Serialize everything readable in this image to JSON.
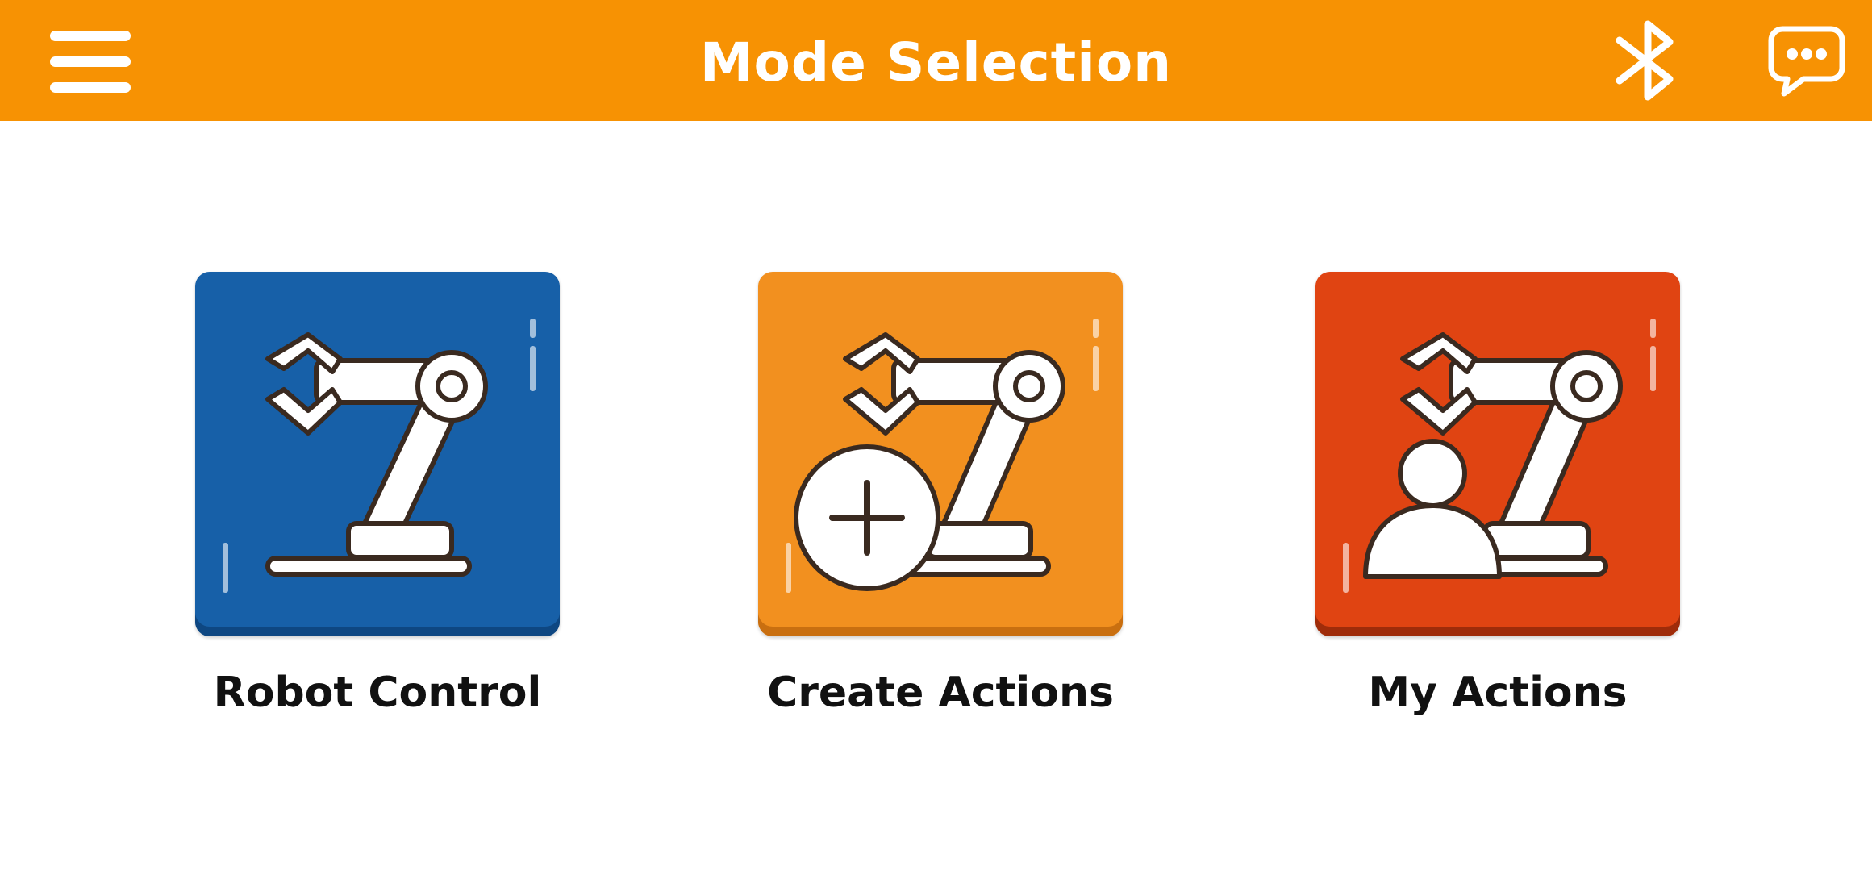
{
  "app_bar": {
    "title": "Mode Selection",
    "background_color": "#f79203",
    "menu_icon": "hamburger-menu-icon",
    "bluetooth_icon": "bluetooth-icon",
    "chat_icon": "chat-bubble-icon"
  },
  "modes": [
    {
      "label": "Robot Control",
      "icon": "robot-arm-icon",
      "color": "#1760a8"
    },
    {
      "label": "Create Actions",
      "icon": "robot-arm-add-icon",
      "color": "#f2901f"
    },
    {
      "label": "My Actions",
      "icon": "robot-arm-user-icon",
      "color": "#e04412"
    }
  ]
}
